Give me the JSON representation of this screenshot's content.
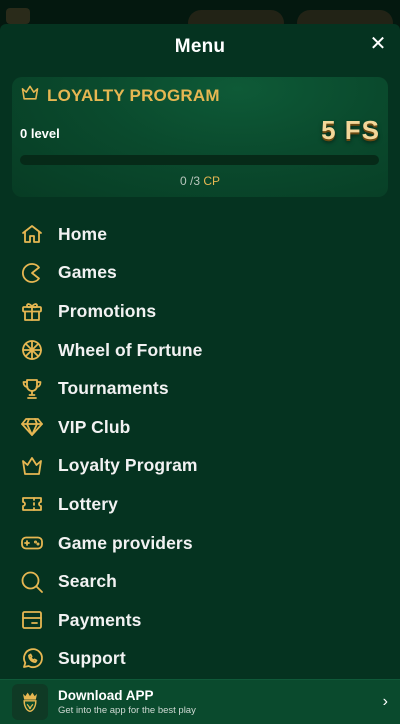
{
  "menu": {
    "title": "Menu",
    "close_icon": "close-icon"
  },
  "loyalty": {
    "title": "LOYALTY PROGRAM",
    "level": "0 level",
    "reward": "5 FS",
    "progress_current": "0",
    "progress_sep": " /3 ",
    "progress_unit": "CP",
    "progress_fraction": 0,
    "icon": "crown-icon"
  },
  "nav": [
    {
      "label": "Home",
      "icon": "home-icon"
    },
    {
      "label": "Games",
      "icon": "games-icon"
    },
    {
      "label": "Promotions",
      "icon": "gift-icon"
    },
    {
      "label": "Wheel of Fortune",
      "icon": "wheel-icon"
    },
    {
      "label": "Tournaments",
      "icon": "trophy-icon"
    },
    {
      "label": "VIP Club",
      "icon": "diamond-icon"
    },
    {
      "label": "Loyalty Program",
      "icon": "crown-icon"
    },
    {
      "label": "Lottery",
      "icon": "ticket-icon"
    },
    {
      "label": "Game providers",
      "icon": "gamepad-icon"
    },
    {
      "label": "Search",
      "icon": "search-icon"
    },
    {
      "label": "Payments",
      "icon": "wallet-icon"
    },
    {
      "label": "Support",
      "icon": "whatsapp-icon"
    }
  ],
  "download": {
    "title": "Download APP",
    "subtitle": "Get into the app for the best play",
    "icon": "app-logo-icon"
  },
  "colors": {
    "accent": "#e6b752",
    "drawer_bg": "#053320",
    "card_bg": "#0a4a2d"
  }
}
